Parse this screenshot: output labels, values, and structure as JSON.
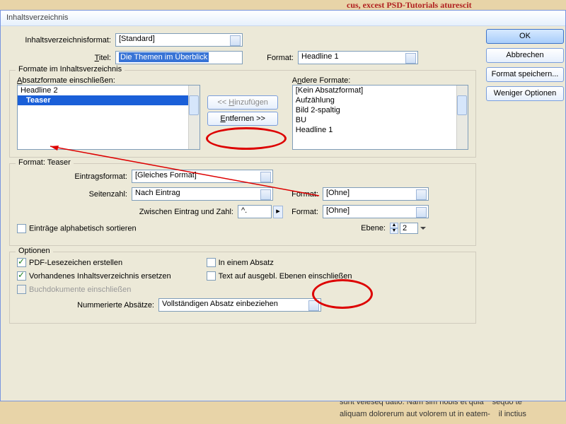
{
  "bg": {
    "top": "cus, excest PSD-Tutorials aturescit",
    "bot1": "sunt veleseq uatio. Nam sim nobis et quia",
    "bot2": "aliquam dolorerum aut volorem ut in eatem-",
    "bot3": "sequo te",
    "bot4": "il inctius"
  },
  "win": {
    "title": "Inhaltsverzeichnis"
  },
  "top": {
    "format_lbl": "Inhaltsverzeichnisformat:",
    "format_val": "[Standard]",
    "title_lbl": "Titel:",
    "title_val": "Die Themen im Überblick",
    "tformat_lbl": "Format:",
    "tformat_val": "Headline 1"
  },
  "buttons": {
    "ok": "OK",
    "cancel": "Abbrechen",
    "save": "Format speichern...",
    "less": "Weniger Optionen"
  },
  "fs1": {
    "legend": "Formate im Inhaltsverzeichnis",
    "left_lbl": "Absatzformate einschließen:",
    "right_lbl": "Andere Formate:",
    "add": "<< Hinzufügen",
    "remove": "Entfernen >>",
    "left_items": {
      "a": "Headline 2",
      "b": "Teaser"
    },
    "right_items": {
      "a": "[Kein Absatzformat]",
      "b": "Aufzählung",
      "c": "Bild 2-spaltig",
      "d": "BU",
      "e": "Headline 1"
    }
  },
  "fs2": {
    "legend": "Format: Teaser",
    "entry_lbl": "Eintragsformat:",
    "entry_val": "[Gleiches Format]",
    "page_lbl": "Seitenzahl:",
    "page_val": "Nach Eintrag",
    "page_fmt_lbl": "Format:",
    "page_fmt_val": "[Ohne]",
    "between_lbl": "Zwischen Eintrag und Zahl:",
    "between_val": "^.",
    "between_fmt_lbl": "Format:",
    "between_fmt_val": "[Ohne]",
    "alpha": "Einträge alphabetisch sortieren",
    "level_lbl": "Ebene:",
    "level_val": "2"
  },
  "fs3": {
    "legend": "Optionen",
    "o1": "PDF-Lesezeichen erstellen",
    "o2": "Vorhandenes Inhaltsverzeichnis ersetzen",
    "o3": "Buchdokumente einschließen",
    "o4": "In einem Absatz",
    "o5": "Text auf ausgebl. Ebenen einschließen",
    "num_lbl": "Nummerierte Absätze:",
    "num_val": "Vollständigen Absatz einbeziehen"
  }
}
